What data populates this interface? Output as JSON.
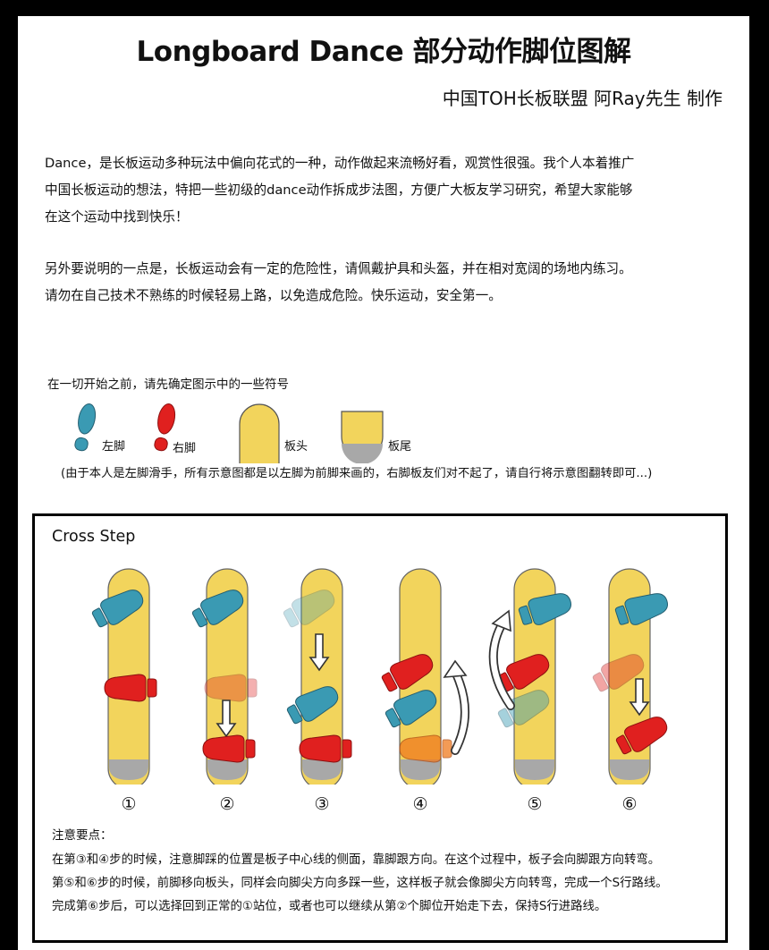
{
  "title": "Longboard Dance 部分动作脚位图解",
  "credit": "中国TOH长板联盟  阿Ray先生 制作",
  "intro": {
    "p1_lines": [
      "Dance，是长板运动多种玩法中偏向花式的一种，动作做起来流畅好看，观赏性很强。我个人本着推广",
      "中国长板运动的想法，特把一些初级的dance动作拆成步法图，方便广大板友学习研究，希望大家能够",
      "在这个运动中找到快乐！"
    ],
    "p2_lines": [
      "另外要说明的一点是，长板运动会有一定的危险性，请佩戴护具和头盔，并在相对宽阔的场地内练习。",
      "请勿在自己技术不熟练的时候轻易上路，以免造成危险。快乐运动，安全第一。"
    ]
  },
  "legend": {
    "title": "在一切开始之前，请先确定图示中的一些符号",
    "left_foot": "左脚",
    "right_foot": "右脚",
    "board_nose": "板头",
    "board_tail": "板尾",
    "note": "(由于本人是左脚滑手，所有示意图都是以左脚为前脚来画的，右脚板友们对不起了，请自行将示意图翻转即可...)"
  },
  "colors": {
    "left_foot": "#3a9ab3",
    "right_foot": "#e0201f",
    "board": "#f2d45c",
    "tail": "#a8a8a8"
  },
  "section": {
    "title": "Cross Step",
    "steps": [
      "①",
      "②",
      "③",
      "④",
      "⑤",
      "⑥"
    ],
    "notes_title": "注意要点：",
    "notes": [
      "在第③和④步的时候，注意脚踩的位置是板子中心线的侧面，靠脚跟方向。在这个过程中，板子会向脚跟方向转弯。",
      "第⑤和⑥步的时候，前脚移向板头，同样会向脚尖方向多踩一些，这样板子就会像脚尖方向转弯，完成一个S行路线。",
      "完成第⑥步后，可以选择回到正常的①站位，或者也可以继续从第②个脚位开始走下去，保持S行进路线。"
    ]
  }
}
